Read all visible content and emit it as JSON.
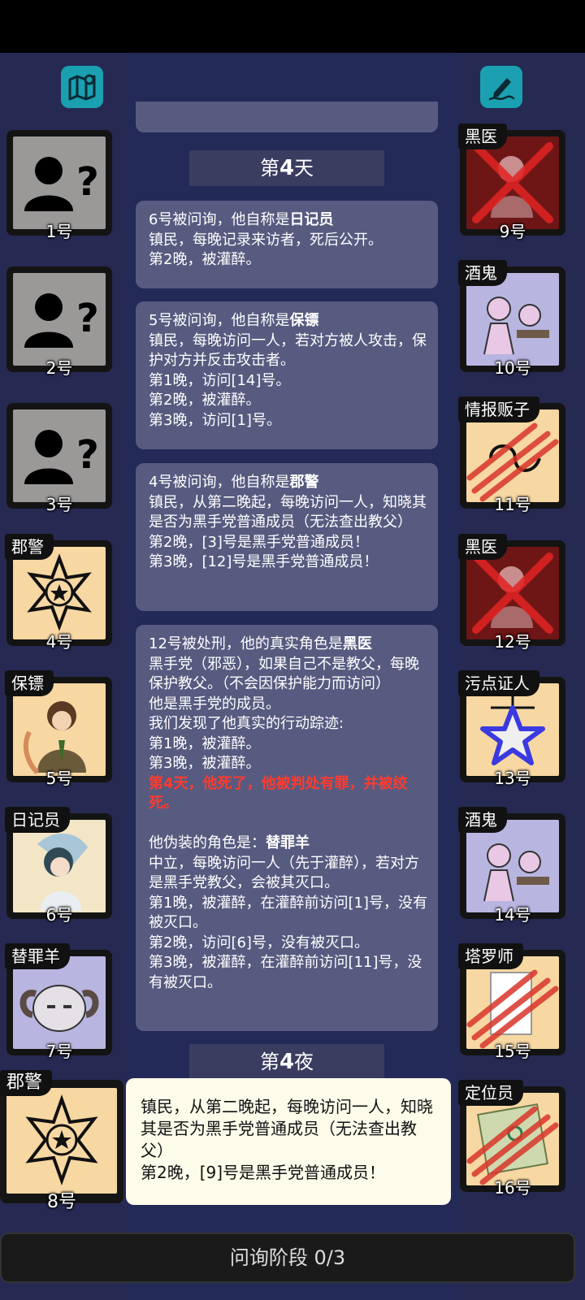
{
  "phase_label": "问询阶段 0/3",
  "day_banner": {
    "prefix": "第",
    "num": "4",
    "suffix": "天"
  },
  "night_banner": {
    "prefix": "第",
    "num": "4",
    "suffix": "夜"
  },
  "messages": [
    {
      "head": "6号被问询，他自称是",
      "role": "日记员",
      "lines": "镇民，每晚记录来访者，死后公开。\n第2晚，被灌醉。"
    },
    {
      "head": "5号被问询，他自称是",
      "role": "保镖",
      "lines": "镇民，每晚访问一人，若对方被人攻击，保护对方并反击攻击者。\n第1晚，访问[14]号。\n第2晚，被灌醉。\n第3晚，访问[1]号。"
    },
    {
      "head": "4号被问询，他自称是",
      "role": "郡警",
      "lines": "镇民，从第二晚起，每晚访问一人，知晓其是否为黑手党普通成员（无法查出教父）\n第2晚，[3]号是黑手党普通成员！\n第3晚，[12]号是黑手党普通成员！"
    },
    {
      "head": "12号被处刑，他的真实角色是",
      "role": "黑医",
      "lines": "黑手党（邪恶），如果自己不是教父，每晚保护教父。（不会因保护能力而访问）\n他是黑手党的成员。\n我们发现了他真实的行动踪迹:\n第1晚，被灌醉。\n第3晚，被灌醉。",
      "red": "第4天，他死了，他被判处有罪，并被绞死。",
      "fake_head": "他伪装的角色是：",
      "fake_role": "替罪羊",
      "fake_lines": "中立，每晚访问一人（先于灌醉），若对方是黑手党教父，会被其灭口。\n第1晚，被灌醉，在灌醉前访问[1]号，没有被灭口。\n第2晚，访问[6]号，没有被灭口。\n第3晚，被灌醉，在灌醉前访问[11]号，没有被灭口。"
    }
  ],
  "tooltip": "镇民，从第二晚起，每晚访问一人，知晓其是否为黑手党普通成员（无法查出教父）\n第2晚，[9]号是黑手党普通成员！",
  "left_players": [
    {
      "num": "1号",
      "role": ""
    },
    {
      "num": "2号",
      "role": ""
    },
    {
      "num": "3号",
      "role": ""
    },
    {
      "num": "4号",
      "role": "郡警"
    },
    {
      "num": "5号",
      "role": "保镖"
    },
    {
      "num": "6号",
      "role": "日记员"
    },
    {
      "num": "7号",
      "role": "替罪羊"
    },
    {
      "num": "8号",
      "role": "郡警"
    }
  ],
  "right_players": [
    {
      "num": "9号",
      "role": "黑医"
    },
    {
      "num": "10号",
      "role": "酒鬼"
    },
    {
      "num": "11号",
      "role": "情报贩子"
    },
    {
      "num": "12号",
      "role": "黑医"
    },
    {
      "num": "13号",
      "role": "污点证人"
    },
    {
      "num": "14号",
      "role": "酒鬼"
    },
    {
      "num": "15号",
      "role": "塔罗师"
    },
    {
      "num": "16号",
      "role": "定位员"
    }
  ]
}
